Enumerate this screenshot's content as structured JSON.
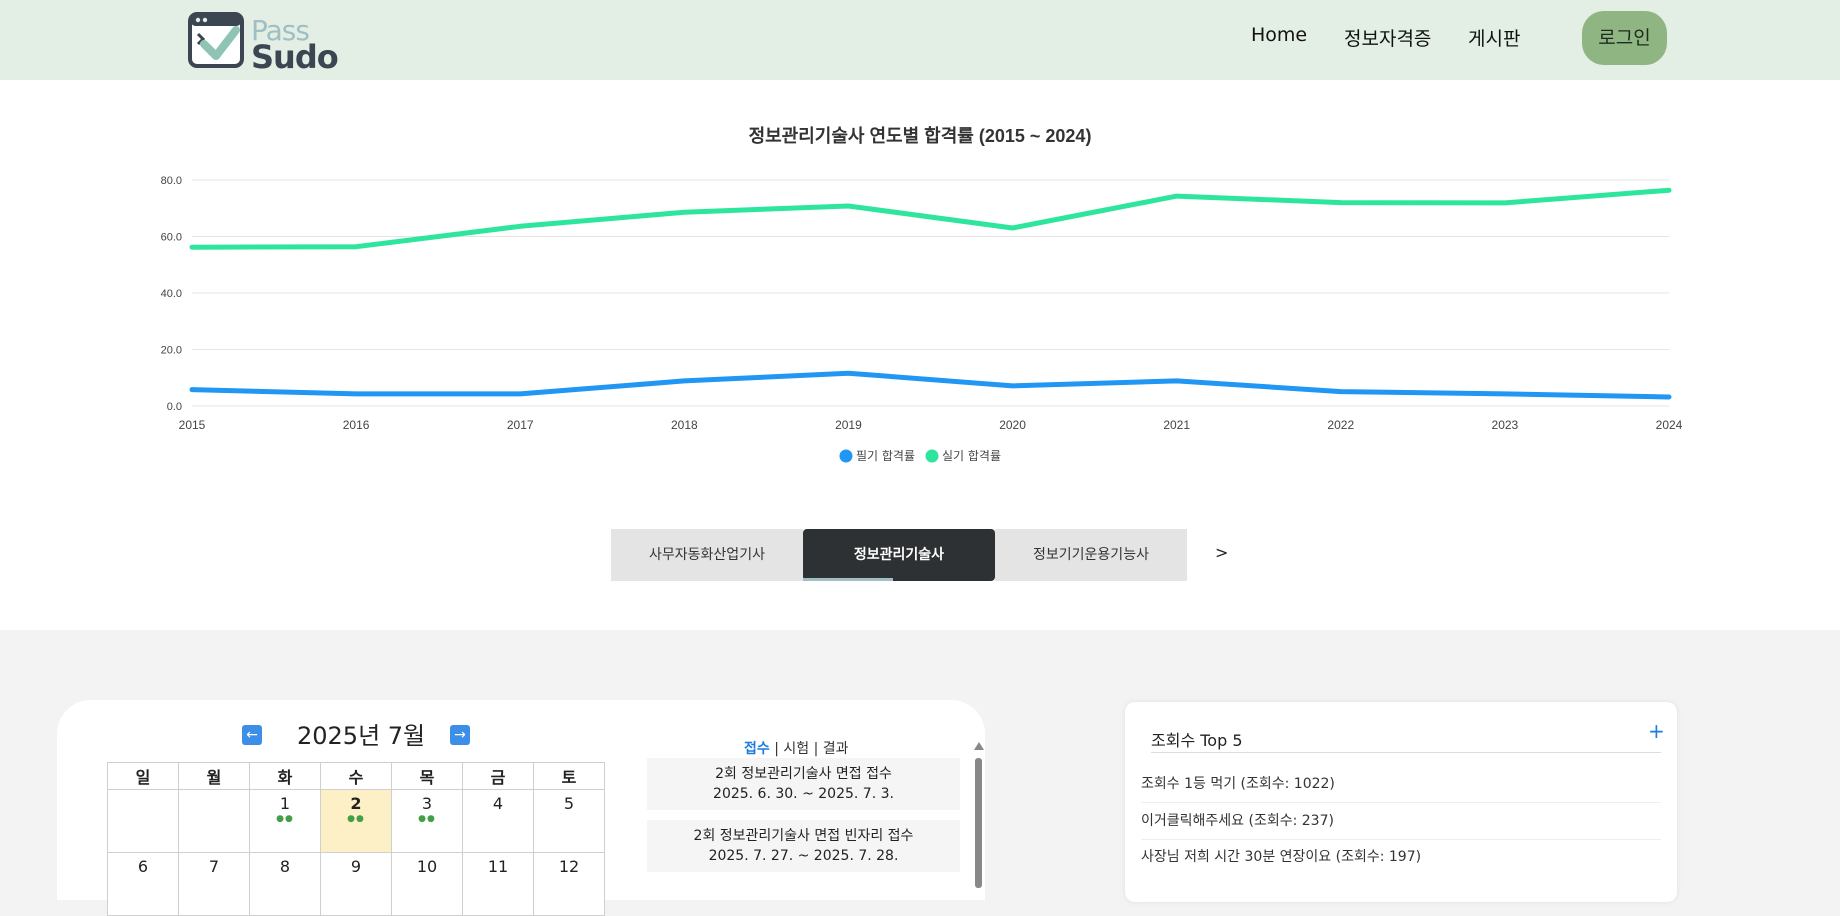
{
  "header": {
    "logo_line1": "Pass",
    "logo_line2": "Sudo",
    "nav": [
      "Home",
      "정보자격증",
      "게시판"
    ],
    "login_label": "로그인",
    "bg_color": "#e3efe5",
    "login_color": "#8fb582"
  },
  "chart_data": {
    "type": "line",
    "title": "정보관리기술사 연도별 합격률 (2015 ~ 2024)",
    "x": [
      "2015",
      "2016",
      "2017",
      "2018",
      "2019",
      "2020",
      "2021",
      "2022",
      "2023",
      "2024"
    ],
    "ylim": [
      0,
      80
    ],
    "yticks": [
      "80.0",
      "60.0",
      "40.0",
      "20.0",
      "0.0"
    ],
    "grid": true,
    "legend_position": "bottom",
    "series": [
      {
        "name": "필기 합격률",
        "color": "#2196f3",
        "values": [
          5.8,
          4.3,
          4.3,
          8.9,
          11.6,
          7.1,
          8.9,
          5.1,
          4.3,
          3.2
        ]
      },
      {
        "name": "실기 합격률",
        "color": "#2ee59d",
        "values": [
          56.2,
          56.4,
          63.6,
          68.6,
          70.8,
          63.0,
          74.3,
          72.0,
          71.9,
          76.4
        ]
      }
    ]
  },
  "tabs": {
    "items": [
      "사무자동화산업기사",
      "정보관리기술사",
      "정보기기운용기능사"
    ],
    "active_index": 1,
    "next_label": ">"
  },
  "calendar": {
    "prev_icon": "←",
    "next_icon": "→",
    "month_label": "2025년 7월",
    "weekdays": [
      "일",
      "월",
      "화",
      "수",
      "목",
      "금",
      "토"
    ],
    "week1": [
      "",
      "",
      "1",
      "2",
      "3",
      "4",
      "5"
    ],
    "week2": [
      "6",
      "7",
      "8",
      "9",
      "10",
      "11",
      "12"
    ],
    "dot_mark": "●●",
    "today": "2"
  },
  "schedule": {
    "tab_labels": [
      "접수",
      "| 시험",
      "| 결과"
    ],
    "items": [
      {
        "title": "2회 정보관리기술사 면접 접수",
        "date": "2025. 6. 30. ~ 2025. 7. 3."
      },
      {
        "title": "2회 정보관리기술사 면접 빈자리 접수",
        "date": "2025. 7. 27. ~ 2025. 7. 28."
      }
    ]
  },
  "top5": {
    "title": "조회수 Top 5",
    "more_label": "+",
    "items": [
      "조회수 1등 먹기 (조회수: 1022)",
      "이거클릭해주세요 (조회수: 237)",
      "사장님 저희 시간 30분 연장이요 (조회수: 197)"
    ]
  }
}
